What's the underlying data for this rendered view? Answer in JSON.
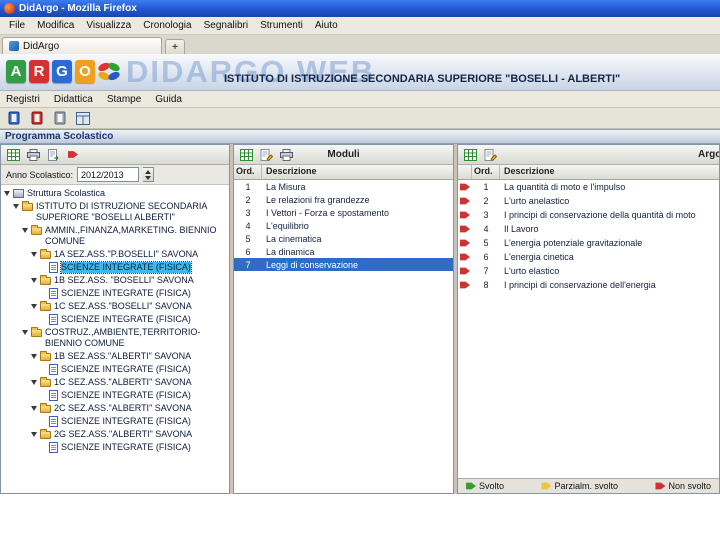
{
  "browser": {
    "title": "DidArgo - Mozilla Firefox",
    "menus": [
      "File",
      "Modifica",
      "Visualizza",
      "Cronologia",
      "Segnalibri",
      "Strumenti",
      "Aiuto"
    ],
    "tab": "DidArgo",
    "new_tab_label": "+"
  },
  "app": {
    "logo_letters": [
      "A",
      "R",
      "G",
      "O"
    ],
    "logo_colors": [
      "#2f9e44",
      "#d63030",
      "#2b6cd4",
      "#f0a020"
    ],
    "watermark": "DIDARGO WEB",
    "school_header": "ISTITUTO DI ISTRUZIONE SECONDARIA SUPERIORE \"BOSELLI - ALBERTI\"",
    "menus": [
      "Registri",
      "Didattica",
      "Stampe",
      "Guida"
    ],
    "section_title": "Programma Scolastico"
  },
  "colors": {
    "tree_selection": "#3fb8e8",
    "table_selection": "#2f6cc4",
    "status_non_svolto": "#cc3333"
  },
  "left_panel": {
    "anno_label": "Anno Scolastico:",
    "anno_value": "2012/2013",
    "tree": [
      {
        "label": "Struttura Scolastica",
        "level": 0,
        "icon": "root"
      },
      {
        "label": "ISTITUTO DI ISTRUZIONE SECONDARIA SUPERIORE \"BOSELLI ALBERTI\"",
        "level": 1,
        "icon": "folder"
      },
      {
        "label": "AMMIN.,FINANZA,MARKETING. BIENNIO COMUNE",
        "level": 2,
        "icon": "folder"
      },
      {
        "label": "1A SEZ.ASS.\"P.BOSELLI\" SAVONA",
        "level": 3,
        "icon": "folder"
      },
      {
        "label": "SCIENZE INTEGRATE (FISICA)",
        "level": 4,
        "icon": "doc",
        "leaf": true,
        "selected": true
      },
      {
        "label": "1B SEZ.ASS. \"BOSELLI\" SAVONA",
        "level": 3,
        "icon": "folder"
      },
      {
        "label": "SCIENZE INTEGRATE (FISICA)",
        "level": 4,
        "icon": "doc",
        "leaf": true
      },
      {
        "label": "1C SEZ.ASS.\"BOSELLI\" SAVONA",
        "level": 3,
        "icon": "folder"
      },
      {
        "label": "SCIENZE INTEGRATE (FISICA)",
        "level": 4,
        "icon": "doc",
        "leaf": true
      },
      {
        "label": "COSTRUZ.,AMBIENTE,TERRITORIO-BIENNIO COMUNE",
        "level": 2,
        "icon": "folder"
      },
      {
        "label": "1B SEZ.ASS.\"ALBERTI\" SAVONA",
        "level": 3,
        "icon": "folder"
      },
      {
        "label": "SCIENZE INTEGRATE (FISICA)",
        "level": 4,
        "icon": "doc",
        "leaf": true
      },
      {
        "label": "1C SEZ.ASS.\"ALBERTI\" SAVONA",
        "level": 3,
        "icon": "folder"
      },
      {
        "label": "SCIENZE INTEGRATE (FISICA)",
        "level": 4,
        "icon": "doc",
        "leaf": true
      },
      {
        "label": "2C SEZ.ASS.\"ALBERTI\" SAVONA",
        "level": 3,
        "icon": "folder"
      },
      {
        "label": "SCIENZE INTEGRATE (FISICA)",
        "level": 4,
        "icon": "doc",
        "leaf": true
      },
      {
        "label": "2G SEZ.ASS.\"ALBERTI\" SAVONA",
        "level": 3,
        "icon": "folder"
      },
      {
        "label": "SCIENZE INTEGRATE (FISICA)",
        "level": 4,
        "icon": "doc",
        "leaf": true
      }
    ]
  },
  "moduli": {
    "title": "Moduli",
    "columns": [
      "Ord.",
      "Descrizione"
    ],
    "rows": [
      {
        "ord": "1",
        "desc": "La Misura"
      },
      {
        "ord": "2",
        "desc": "Le relazioni fra grandezze"
      },
      {
        "ord": "3",
        "desc": "I Vettori - Forza e spostamento"
      },
      {
        "ord": "4",
        "desc": "L'equilibrio"
      },
      {
        "ord": "5",
        "desc": "La cinematica"
      },
      {
        "ord": "6",
        "desc": "La dinamica"
      },
      {
        "ord": "7",
        "desc": "Leggi di conservazione",
        "selected": true
      }
    ]
  },
  "argomenti": {
    "title": "Argomenti",
    "columns": [
      "Ord.",
      "Descrizione"
    ],
    "rows": [
      {
        "ord": "1",
        "desc": "La quantità di moto e l'impulso",
        "status": "non-svolto"
      },
      {
        "ord": "2",
        "desc": "L'urto anelastico",
        "status": "non-svolto"
      },
      {
        "ord": "3",
        "desc": "I principi di conservazione della quantità di moto",
        "status": "non-svolto"
      },
      {
        "ord": "4",
        "desc": "Il Lavoro",
        "status": "non-svolto"
      },
      {
        "ord": "5",
        "desc": "L'energia potenziale gravitazionale",
        "status": "non-svolto"
      },
      {
        "ord": "6",
        "desc": "L'energia cinetica",
        "status": "non-svolto"
      },
      {
        "ord": "7",
        "desc": "L'urto elastico",
        "status": "non-svolto"
      },
      {
        "ord": "8",
        "desc": "I principi di conservazione dell'energia",
        "status": "non-svolto"
      }
    ],
    "legend": [
      {
        "label": "Svolto",
        "color": "#3a9a3a"
      },
      {
        "label": "Parzialm. svolto",
        "color": "#e8c83a"
      },
      {
        "label": "Non svolto",
        "color": "#cc3333"
      }
    ]
  }
}
